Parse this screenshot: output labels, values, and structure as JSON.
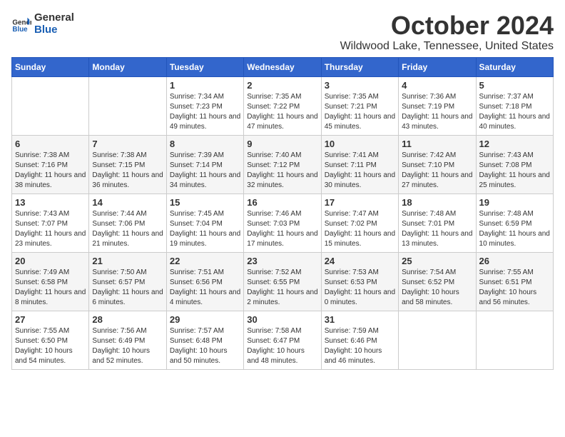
{
  "logo": {
    "line1": "General",
    "line2": "Blue"
  },
  "title": "October 2024",
  "location": "Wildwood Lake, Tennessee, United States",
  "weekdays": [
    "Sunday",
    "Monday",
    "Tuesday",
    "Wednesday",
    "Thursday",
    "Friday",
    "Saturday"
  ],
  "weeks": [
    [
      {
        "day": "",
        "info": ""
      },
      {
        "day": "",
        "info": ""
      },
      {
        "day": "1",
        "info": "Sunrise: 7:34 AM\nSunset: 7:23 PM\nDaylight: 11 hours and 49 minutes."
      },
      {
        "day": "2",
        "info": "Sunrise: 7:35 AM\nSunset: 7:22 PM\nDaylight: 11 hours and 47 minutes."
      },
      {
        "day": "3",
        "info": "Sunrise: 7:35 AM\nSunset: 7:21 PM\nDaylight: 11 hours and 45 minutes."
      },
      {
        "day": "4",
        "info": "Sunrise: 7:36 AM\nSunset: 7:19 PM\nDaylight: 11 hours and 43 minutes."
      },
      {
        "day": "5",
        "info": "Sunrise: 7:37 AM\nSunset: 7:18 PM\nDaylight: 11 hours and 40 minutes."
      }
    ],
    [
      {
        "day": "6",
        "info": "Sunrise: 7:38 AM\nSunset: 7:16 PM\nDaylight: 11 hours and 38 minutes."
      },
      {
        "day": "7",
        "info": "Sunrise: 7:38 AM\nSunset: 7:15 PM\nDaylight: 11 hours and 36 minutes."
      },
      {
        "day": "8",
        "info": "Sunrise: 7:39 AM\nSunset: 7:14 PM\nDaylight: 11 hours and 34 minutes."
      },
      {
        "day": "9",
        "info": "Sunrise: 7:40 AM\nSunset: 7:12 PM\nDaylight: 11 hours and 32 minutes."
      },
      {
        "day": "10",
        "info": "Sunrise: 7:41 AM\nSunset: 7:11 PM\nDaylight: 11 hours and 30 minutes."
      },
      {
        "day": "11",
        "info": "Sunrise: 7:42 AM\nSunset: 7:10 PM\nDaylight: 11 hours and 27 minutes."
      },
      {
        "day": "12",
        "info": "Sunrise: 7:43 AM\nSunset: 7:08 PM\nDaylight: 11 hours and 25 minutes."
      }
    ],
    [
      {
        "day": "13",
        "info": "Sunrise: 7:43 AM\nSunset: 7:07 PM\nDaylight: 11 hours and 23 minutes."
      },
      {
        "day": "14",
        "info": "Sunrise: 7:44 AM\nSunset: 7:06 PM\nDaylight: 11 hours and 21 minutes."
      },
      {
        "day": "15",
        "info": "Sunrise: 7:45 AM\nSunset: 7:04 PM\nDaylight: 11 hours and 19 minutes."
      },
      {
        "day": "16",
        "info": "Sunrise: 7:46 AM\nSunset: 7:03 PM\nDaylight: 11 hours and 17 minutes."
      },
      {
        "day": "17",
        "info": "Sunrise: 7:47 AM\nSunset: 7:02 PM\nDaylight: 11 hours and 15 minutes."
      },
      {
        "day": "18",
        "info": "Sunrise: 7:48 AM\nSunset: 7:01 PM\nDaylight: 11 hours and 13 minutes."
      },
      {
        "day": "19",
        "info": "Sunrise: 7:48 AM\nSunset: 6:59 PM\nDaylight: 11 hours and 10 minutes."
      }
    ],
    [
      {
        "day": "20",
        "info": "Sunrise: 7:49 AM\nSunset: 6:58 PM\nDaylight: 11 hours and 8 minutes."
      },
      {
        "day": "21",
        "info": "Sunrise: 7:50 AM\nSunset: 6:57 PM\nDaylight: 11 hours and 6 minutes."
      },
      {
        "day": "22",
        "info": "Sunrise: 7:51 AM\nSunset: 6:56 PM\nDaylight: 11 hours and 4 minutes."
      },
      {
        "day": "23",
        "info": "Sunrise: 7:52 AM\nSunset: 6:55 PM\nDaylight: 11 hours and 2 minutes."
      },
      {
        "day": "24",
        "info": "Sunrise: 7:53 AM\nSunset: 6:53 PM\nDaylight: 11 hours and 0 minutes."
      },
      {
        "day": "25",
        "info": "Sunrise: 7:54 AM\nSunset: 6:52 PM\nDaylight: 10 hours and 58 minutes."
      },
      {
        "day": "26",
        "info": "Sunrise: 7:55 AM\nSunset: 6:51 PM\nDaylight: 10 hours and 56 minutes."
      }
    ],
    [
      {
        "day": "27",
        "info": "Sunrise: 7:55 AM\nSunset: 6:50 PM\nDaylight: 10 hours and 54 minutes."
      },
      {
        "day": "28",
        "info": "Sunrise: 7:56 AM\nSunset: 6:49 PM\nDaylight: 10 hours and 52 minutes."
      },
      {
        "day": "29",
        "info": "Sunrise: 7:57 AM\nSunset: 6:48 PM\nDaylight: 10 hours and 50 minutes."
      },
      {
        "day": "30",
        "info": "Sunrise: 7:58 AM\nSunset: 6:47 PM\nDaylight: 10 hours and 48 minutes."
      },
      {
        "day": "31",
        "info": "Sunrise: 7:59 AM\nSunset: 6:46 PM\nDaylight: 10 hours and 46 minutes."
      },
      {
        "day": "",
        "info": ""
      },
      {
        "day": "",
        "info": ""
      }
    ]
  ]
}
